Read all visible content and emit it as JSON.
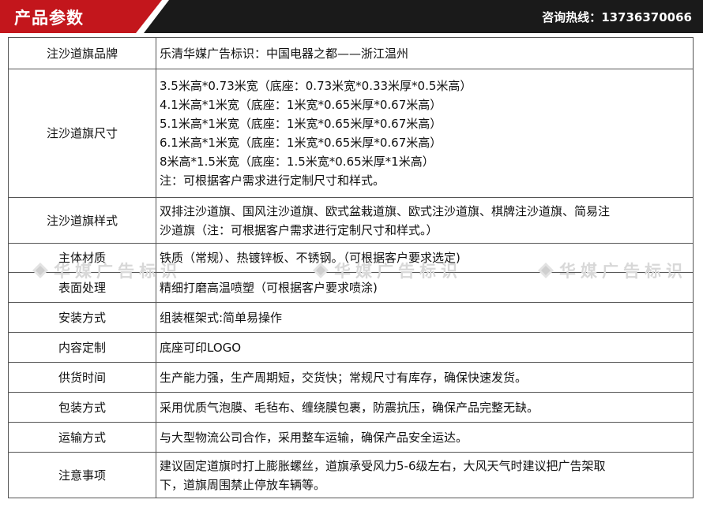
{
  "header": {
    "title": "产品参数",
    "hotline_label": "咨询热线：",
    "hotline_number": "13736370066"
  },
  "watermark": {
    "text": "华媒广告标识"
  },
  "params": [
    {
      "key": "注沙道旗品牌",
      "lines": [
        "乐清华媒广告标识：中国电器之都——浙江温州"
      ]
    },
    {
      "key": "注沙道旗尺寸",
      "lines": [
        "3.5米高*0.73米宽（底座：0.73米宽*0.33米厚*0.5米高）",
        "4.1米高*1米宽（底座：1米宽*0.65米厚*0.67米高）",
        "5.1米高*1米宽（底座：1米宽*0.65米厚*0.67米高）",
        "6.1米高*1米宽（底座：1米宽*0.65米厚*0.67米高）",
        "8米高*1.5米宽（底座：1.5米宽*0.65米厚*1米高）",
        "注：可根据客户需求进行定制尺寸和样式。"
      ]
    },
    {
      "key": "注沙道旗样式",
      "lines": [
        "双排注沙道旗、国风注沙道旗、欧式盆栽道旗、欧式注沙道旗、棋牌注沙道旗、简易注",
        "沙道旗（注：可根据客户需求进行定制尺寸和样式。）"
      ]
    },
    {
      "key": "主体材质",
      "lines": [
        "铁质（常规）、热镀锌板、不锈钢。（可根据客户要求选定)"
      ]
    },
    {
      "key": "表面处理",
      "lines": [
        "精细打磨高温喷塑（可根据客户要求喷涂)"
      ]
    },
    {
      "key": "安装方式",
      "lines": [
        "组装框架式:简单易操作"
      ]
    },
    {
      "key": "内容定制",
      "lines": [
        "底座可印LOGO"
      ]
    },
    {
      "key": "供货时间",
      "lines": [
        "生产能力强，生产周期短，交货快；常规尺寸有库存，确保快速发货。"
      ]
    },
    {
      "key": "包装方式",
      "lines": [
        "采用优质气泡膜、毛毡布、缠绕膜包裹，防震抗压，确保产品完整无缺。"
      ]
    },
    {
      "key": "运输方式",
      "lines": [
        "与大型物流公司合作，采用整车运输，确保产品安全运达。"
      ]
    },
    {
      "key": "注意事项",
      "lines": [
        "建议固定道旗时打上膨胀螺丝，道旗承受风力5-6级左右，大风天气时建议把广告架取",
        "下，道旗周围禁止停放车辆等。"
      ]
    }
  ]
}
